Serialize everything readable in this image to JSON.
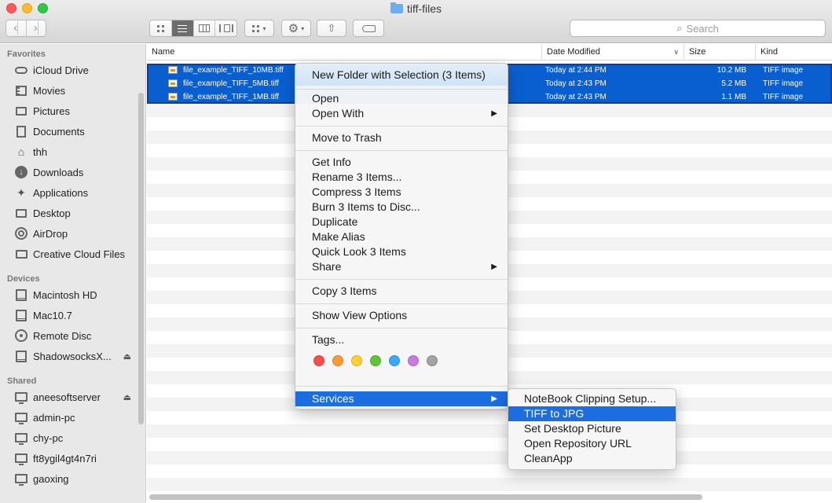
{
  "window": {
    "title": "tiff-files"
  },
  "toolbar": {
    "back_icon": "chevron-left-icon",
    "forward_icon": "chevron-right-icon",
    "search_placeholder": "Search"
  },
  "sidebar": {
    "favorites_label": "Favorites",
    "favorites": [
      {
        "label": "iCloud Drive",
        "icon": "cloud-icon"
      },
      {
        "label": "Movies",
        "icon": "film-icon"
      },
      {
        "label": "Pictures",
        "icon": "camera-icon"
      },
      {
        "label": "Documents",
        "icon": "document-icon"
      },
      {
        "label": "thh",
        "icon": "home-icon"
      },
      {
        "label": "Downloads",
        "icon": "download-icon"
      },
      {
        "label": "Applications",
        "icon": "applications-icon"
      },
      {
        "label": "Desktop",
        "icon": "desktop-icon"
      },
      {
        "label": "AirDrop",
        "icon": "airdrop-icon"
      },
      {
        "label": "Creative Cloud Files",
        "icon": "folder-icon"
      }
    ],
    "devices_label": "Devices",
    "devices": [
      {
        "label": "Macintosh HD",
        "icon": "drive-icon"
      },
      {
        "label": "Mac10.7",
        "icon": "drive-icon"
      },
      {
        "label": "Remote Disc",
        "icon": "disc-icon"
      },
      {
        "label": "ShadowsocksX...",
        "icon": "drive-icon",
        "eject": "⏏"
      }
    ],
    "shared_label": "Shared",
    "shared": [
      {
        "label": "aneesoftserver",
        "icon": "computer-icon",
        "eject": "⏏"
      },
      {
        "label": "admin-pc",
        "icon": "computer-icon"
      },
      {
        "label": "chy-pc",
        "icon": "computer-icon"
      },
      {
        "label": "ft8ygil4gt4n7ri",
        "icon": "computer-icon"
      },
      {
        "label": "gaoxing",
        "icon": "computer-icon"
      }
    ]
  },
  "columns": {
    "name": "Name",
    "date": "Date Modified",
    "size": "Size",
    "kind": "Kind"
  },
  "files": [
    {
      "name": "file_example_TIFF_10MB.tiff",
      "date": "Today at 2:44 PM",
      "size": "10.2 MB",
      "kind": "TIFF image"
    },
    {
      "name": "file_example_TIFF_5MB.tiff",
      "date": "Today at 2:43 PM",
      "size": "5.2 MB",
      "kind": "TIFF image"
    },
    {
      "name": "file_example_TIFF_1MB.tiff",
      "date": "Today at 2:43 PM",
      "size": "1.1 MB",
      "kind": "TIFF image"
    }
  ],
  "context_menu": {
    "new_folder": "New Folder with Selection (3 Items)",
    "open": "Open",
    "open_with": "Open With",
    "move_to_trash": "Move to Trash",
    "get_info": "Get Info",
    "rename": "Rename 3 Items...",
    "compress": "Compress 3 Items",
    "burn": "Burn 3 Items to Disc...",
    "duplicate": "Duplicate",
    "make_alias": "Make Alias",
    "quick_look": "Quick Look 3 Items",
    "share": "Share",
    "copy": "Copy 3 Items",
    "show_view_options": "Show View Options",
    "tags": "Tags...",
    "services": "Services",
    "tag_colors": [
      "#fc4c4c",
      "#fd9a32",
      "#fcd02f",
      "#5cc638",
      "#39a8f8",
      "#c97ae0",
      "#a3a3a3"
    ]
  },
  "services_menu": {
    "items": [
      "NoteBook Clipping Setup...",
      "TIFF to JPG",
      "Set Desktop Picture",
      "Open Repository URL",
      "CleanApp"
    ],
    "highlighted": "TIFF to JPG"
  }
}
